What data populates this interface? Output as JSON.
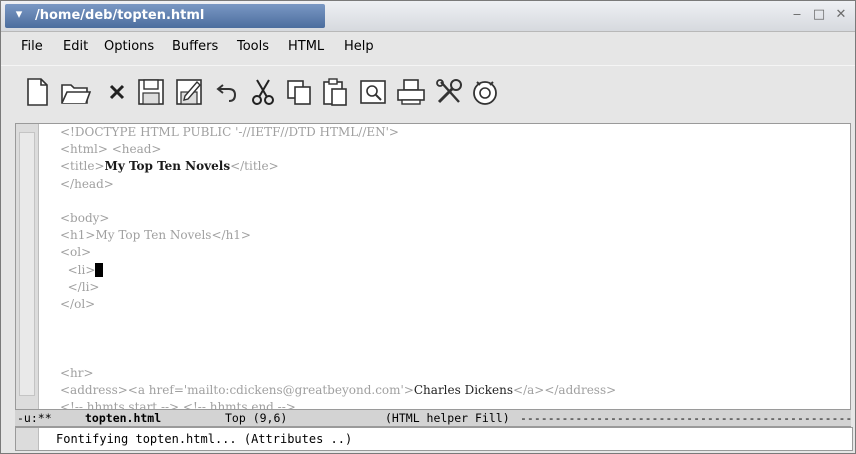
{
  "window": {
    "title": "/home/deb/topten.html",
    "controls": [
      "minimize-icon",
      "maximize-icon",
      "close-icon"
    ]
  },
  "menu": {
    "items": [
      {
        "label": "File"
      },
      {
        "label": "Edit"
      },
      {
        "label": "Options"
      },
      {
        "label": "Buffers"
      },
      {
        "label": "Tools"
      },
      {
        "label": "HTML"
      },
      {
        "label": "Help"
      }
    ]
  },
  "toolbar": {
    "icons": [
      "new-file-icon",
      "open-folder-icon",
      "close-buffer-icon",
      "save-icon",
      "save-as-icon",
      "undo-icon",
      "cut-icon",
      "copy-icon",
      "paste-icon",
      "search-icon",
      "print-icon",
      "preferences-icon",
      "help-icon"
    ]
  },
  "editor": {
    "lines": {
      "l1": "<!DOCTYPE HTML PUBLIC '-//IETF//DTD HTML//EN'>",
      "l2": "<html> <head>",
      "l3a": "<title>",
      "l3b": "My Top Ten Novels",
      "l3c": "</title>",
      "l4": "</head>",
      "l6": "<body>",
      "l7": "<h1>My Top Ten Novels</h1>",
      "l8": "<ol>",
      "l9": "  <li>",
      "l10": "  </li>",
      "l11": "</ol>",
      "l15": "<hr>",
      "l16a": "<address><a href='mailto:cdickens@greatbeyond.com'>",
      "l16b": "Charles Dickens",
      "l16c": "</a></address>",
      "l17": "<!-- hhmts start --> <!-- hhmts end -->"
    }
  },
  "modeline": {
    "flags": "-u:**",
    "buffer": "topten.html",
    "position": "Top (9,6)",
    "mode": "(HTML helper Fill)",
    "fill": "------------------------------------------------"
  },
  "echo": {
    "message": "Fontifying topten.html... (Attributes ..)"
  }
}
